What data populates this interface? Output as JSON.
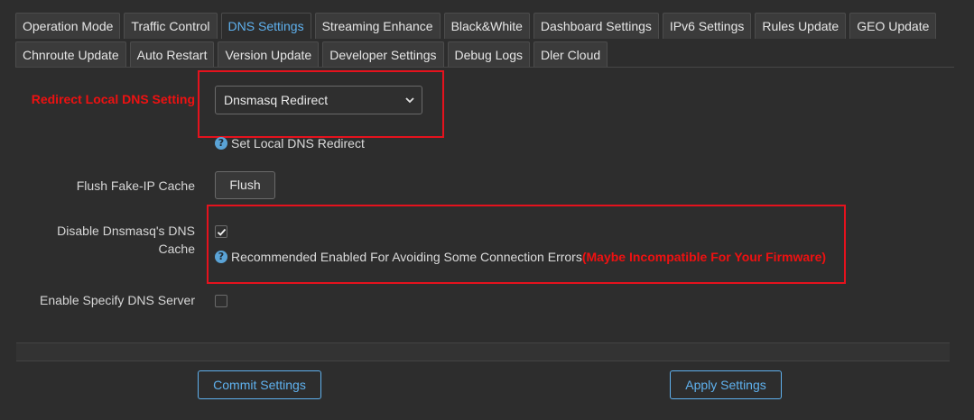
{
  "tabs": {
    "row1": [
      "Operation Mode",
      "Traffic Control",
      "DNS Settings",
      "Streaming Enhance",
      "Black&White",
      "Dashboard Settings",
      "IPv6 Settings",
      "Rules Update",
      "GEO Update"
    ],
    "row2": [
      "Chnroute Update",
      "Auto Restart",
      "Version Update",
      "Developer Settings",
      "Debug Logs",
      "Dler Cloud"
    ],
    "active": "DNS Settings"
  },
  "redirect": {
    "label": "Redirect Local DNS Setting",
    "selected": "Dnsmasq Redirect",
    "help": "Set Local DNS Redirect"
  },
  "flush": {
    "label": "Flush Fake-IP Cache",
    "button": "Flush"
  },
  "dnsmasq_cache": {
    "label_line1": "Disable Dnsmasq's DNS",
    "label_line2": "Cache",
    "checked": true,
    "help": "Recommended Enabled For Avoiding Some Connection Errors",
    "warning": "(Maybe Incompatible For Your Firmware)"
  },
  "specify_dns": {
    "label": "Enable Specify DNS Server",
    "checked": false
  },
  "footer": {
    "commit": "Commit Settings",
    "apply": "Apply Settings"
  },
  "colors": {
    "accent": "#5fb1ee",
    "highlight": "#e5121d",
    "background": "#2d2d2d"
  }
}
